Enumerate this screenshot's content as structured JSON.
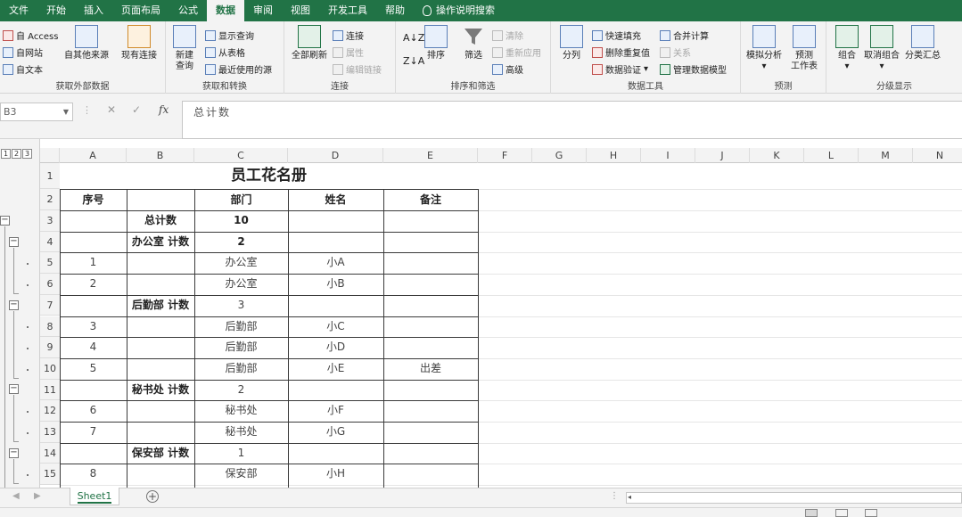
{
  "ribbon_tabs": [
    "文件",
    "开始",
    "插入",
    "页面布局",
    "公式",
    "数据",
    "审阅",
    "视图",
    "开发工具",
    "帮助"
  ],
  "active_tab": "数据",
  "tell_me": "操作说明搜索",
  "groups": {
    "get_external": {
      "label": "获取外部数据",
      "from_access": "自 Access",
      "from_web": "自网站",
      "from_text": "自文本",
      "other_sources": "自其他来源",
      "existing_conn": "现有连接"
    },
    "get_transform": {
      "label": "获取和转换",
      "new_query_1": "新建",
      "new_query_2": "查询",
      "show_queries": "显示查询",
      "from_table": "从表格",
      "recent_sources": "最近使用的源"
    },
    "connections": {
      "label": "连接",
      "refresh_all": "全部刷新",
      "connections": "连接",
      "properties": "属性",
      "edit_links": "编辑链接"
    },
    "sort_filter": {
      "label": "排序和筛选",
      "sort": "排序",
      "filter": "筛选",
      "clear": "清除",
      "reapply": "重新应用",
      "advanced": "高级"
    },
    "data_tools": {
      "label": "数据工具",
      "text_to_columns": "分列",
      "flash_fill": "快速填充",
      "remove_dup": "删除重复值",
      "validation": "数据验证",
      "consolidate": "合并计算",
      "relationships": "关系",
      "data_model": "管理数据模型"
    },
    "forecast": {
      "label": "预测",
      "what_if": "模拟分析",
      "forecast_1": "预测",
      "forecast_2": "工作表"
    },
    "outline": {
      "label": "分级显示",
      "group": "组合",
      "ungroup": "取消组合",
      "subtotal": "分类汇总"
    }
  },
  "formula_bar": {
    "name_box": "B3",
    "fx": "fx",
    "formula": "总计数"
  },
  "outline_levels": [
    "1",
    "2",
    "3"
  ],
  "columns": [
    "A",
    "B",
    "C",
    "D",
    "E",
    "F",
    "G",
    "H",
    "I",
    "J",
    "K",
    "L",
    "M",
    "N"
  ],
  "rows": [
    {
      "n": "1",
      "a": "",
      "b": "",
      "c": "员工花名册",
      "d": "",
      "e": "",
      "btn": "",
      "dot": false,
      "title": true
    },
    {
      "n": "2",
      "a": "序号",
      "b": "",
      "c": "部门",
      "d": "姓名",
      "e": "备注",
      "btn": "",
      "dot": false,
      "hdr": true
    },
    {
      "n": "3",
      "a": "",
      "b": "总计数",
      "c": "10",
      "d": "",
      "e": "",
      "btn": "L1",
      "dot": false,
      "bold": true
    },
    {
      "n": "4",
      "a": "",
      "b": "办公室 计数",
      "c": "2",
      "d": "",
      "e": "",
      "btn": "L2",
      "dot": false,
      "bold": true
    },
    {
      "n": "5",
      "a": "1",
      "b": "",
      "c": "办公室",
      "d": "小A",
      "e": "",
      "btn": "",
      "dot": true
    },
    {
      "n": "6",
      "a": "2",
      "b": "",
      "c": "办公室",
      "d": "小B",
      "e": "",
      "btn": "",
      "dot": true
    },
    {
      "n": "7",
      "a": "",
      "b": "后勤部 计数",
      "c": "3",
      "d": "",
      "e": "",
      "btn": "L2",
      "dot": false,
      "bbold": true
    },
    {
      "n": "8",
      "a": "3",
      "b": "",
      "c": "后勤部",
      "d": "小C",
      "e": "",
      "btn": "",
      "dot": true
    },
    {
      "n": "9",
      "a": "4",
      "b": "",
      "c": "后勤部",
      "d": "小D",
      "e": "",
      "btn": "",
      "dot": true
    },
    {
      "n": "10",
      "a": "5",
      "b": "",
      "c": "后勤部",
      "d": "小E",
      "e": "出差",
      "btn": "",
      "dot": true
    },
    {
      "n": "11",
      "a": "",
      "b": "秘书处 计数",
      "c": "2",
      "d": "",
      "e": "",
      "btn": "L2",
      "dot": false,
      "bbold": true
    },
    {
      "n": "12",
      "a": "6",
      "b": "",
      "c": "秘书处",
      "d": "小F",
      "e": "",
      "btn": "",
      "dot": true
    },
    {
      "n": "13",
      "a": "7",
      "b": "",
      "c": "秘书处",
      "d": "小G",
      "e": "",
      "btn": "",
      "dot": true
    },
    {
      "n": "14",
      "a": "",
      "b": "保安部 计数",
      "c": "1",
      "d": "",
      "e": "",
      "btn": "L2",
      "dot": false,
      "bbold": true
    },
    {
      "n": "15",
      "a": "8",
      "b": "",
      "c": "保安部",
      "d": "小H",
      "e": "",
      "btn": "",
      "dot": true
    }
  ],
  "sheet_tab": "Sheet1",
  "add_sheet": "+",
  "collapse_symbol": "−",
  "colors": {
    "accent": "#217346",
    "ribbon_bg": "#f3f3f3",
    "border": "#3a3a3a"
  }
}
